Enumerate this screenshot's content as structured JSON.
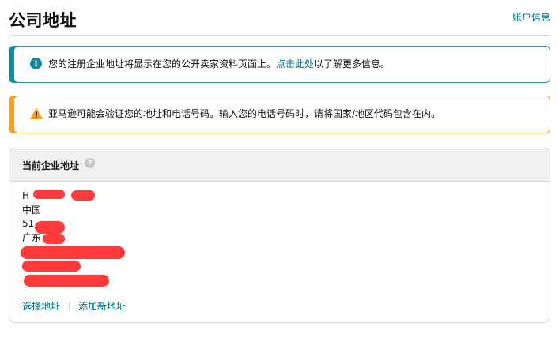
{
  "page": {
    "title": "公司地址",
    "account_link": "账户信息"
  },
  "info_alert": {
    "text_before": "您的注册企业地址将显示在您的公开卖家资料页面上。",
    "link": "点击此处",
    "text_after": "以了解更多信息。",
    "icon": "info-icon",
    "color": "#168a9a"
  },
  "warning_alert": {
    "text": "亚马逊可能会验证您的地址和电话号码。输入您的电话号码时，请将国家/地区代码包含在内。",
    "icon": "warning-icon",
    "color": "#f7a21c"
  },
  "address_card": {
    "title": "当前企业地址",
    "help_icon": "question-icon",
    "lines": [
      "H",
      "中国",
      "51",
      "广东"
    ],
    "redaction_color": "#ff3b3b",
    "links": {
      "choose": "选择地址",
      "add_new": "添加新地址"
    }
  }
}
